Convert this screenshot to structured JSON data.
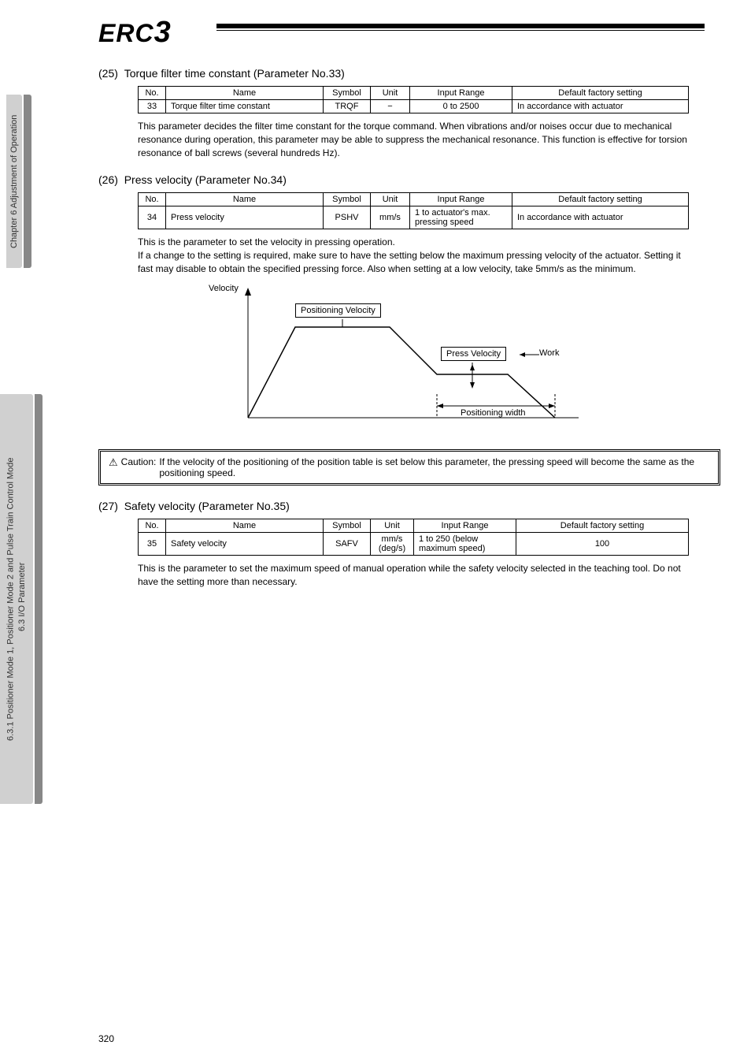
{
  "sidebar": {
    "tab_upper": "Chapter 6 Adjustment of Operation",
    "tab_lower_light": "6.3 I/O Parameter",
    "tab_lower_dark": "6.3.1 Positioner Mode 1, Positioner Mode 2 and Pulse Train Control Mode"
  },
  "logo": "ERC3",
  "sections": [
    {
      "num": "(25)",
      "title": "Torque filter time constant (Parameter No.33)",
      "table": {
        "headers": [
          "No.",
          "Name",
          "Symbol",
          "Unit",
          "Input Range",
          "Default factory setting"
        ],
        "row": [
          "33",
          "Torque filter time constant",
          "TRQF",
          "−",
          "0 to 2500",
          "In accordance with actuator"
        ]
      },
      "body": "This parameter decides the filter time constant for the torque command. When vibrations and/or noises occur due to mechanical resonance during operation, this parameter may be able to suppress the mechanical resonance. This function is effective for torsion resonance of ball screws (several hundreds Hz)."
    },
    {
      "num": "(26)",
      "title": "Press velocity (Parameter No.34)",
      "table": {
        "headers": [
          "No.",
          "Name",
          "Symbol",
          "Unit",
          "Input Range",
          "Default factory setting"
        ],
        "row": [
          "34",
          "Press velocity",
          "PSHV",
          "mm/s",
          "1 to actuator's max. pressing speed",
          "In accordance with actuator"
        ]
      },
      "body": "This is the parameter to set the velocity in pressing operation.\nIf a change to the setting is required, make sure to have the setting below the maximum pressing velocity of the actuator. Setting it fast may disable to obtain the specified pressing force. Also when setting at a low velocity, take 5mm/s as the minimum.",
      "diagram": {
        "y_label": "Velocity",
        "box_positioning": "Positioning Velocity",
        "box_press": "Press Velocity",
        "box_work": "Work",
        "label_width": "Positioning width"
      },
      "caution": {
        "label": "Caution:",
        "text": "If the velocity of the positioning of the position table is set below this parameter, the pressing speed will become the same as the positioning speed."
      }
    },
    {
      "num": "(27)",
      "title": "Safety velocity (Parameter No.35)",
      "table": {
        "headers": [
          "No.",
          "Name",
          "Symbol",
          "Unit",
          "Input Range",
          "Default factory setting"
        ],
        "row": [
          "35",
          "Safety velocity",
          "SAFV",
          "mm/s (deg/s)",
          "1 to 250 (below maximum speed)",
          "100"
        ]
      },
      "body": "This is the parameter to set the maximum speed of manual operation while the safety velocity selected in the teaching tool. Do not have the setting more than necessary."
    }
  ],
  "page_number": "320"
}
